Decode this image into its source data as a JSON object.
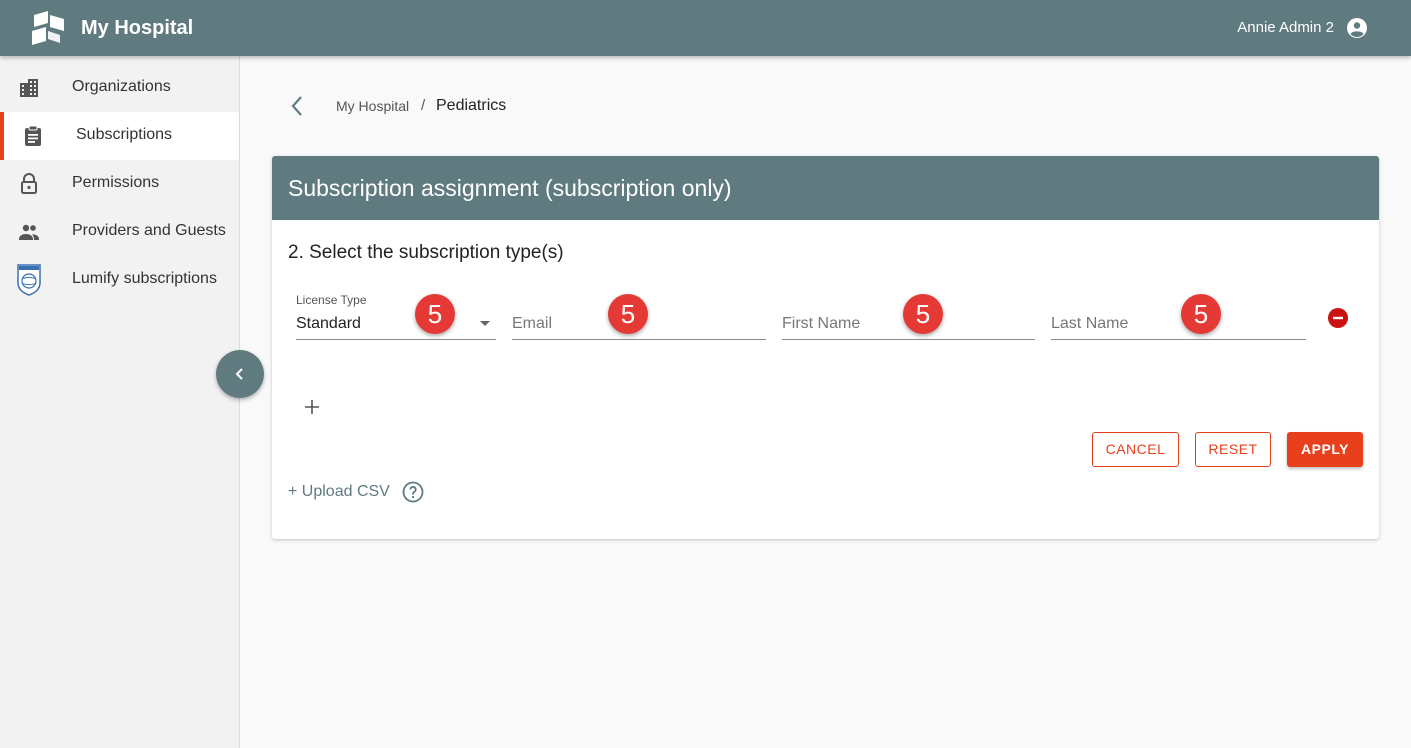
{
  "app": {
    "title": "My Hospital",
    "user_name": "Annie Admin 2"
  },
  "sidebar": {
    "items": [
      {
        "label": "Organizations",
        "icon": "building-icon"
      },
      {
        "label": "Subscriptions",
        "icon": "clipboard-icon",
        "active": true
      },
      {
        "label": "Permissions",
        "icon": "lock-icon"
      },
      {
        "label": "Providers and Guests",
        "icon": "people-icon"
      },
      {
        "label": "Lumify subscriptions",
        "icon": "philips-shield-icon"
      }
    ]
  },
  "breadcrumb": {
    "parent": "My Hospital",
    "separator": "/",
    "current": "Pediatrics"
  },
  "card": {
    "title": "Subscription assignment (subscription only)",
    "step_title": "2. Select the subscription type(s)",
    "license_type": {
      "label": "License Type",
      "value": "Standard"
    },
    "email": {
      "placeholder": "Email"
    },
    "first_name": {
      "placeholder": "First Name"
    },
    "last_name": {
      "placeholder": "Last Name"
    },
    "badges": [
      "5",
      "5",
      "5",
      "5"
    ],
    "buttons": {
      "cancel": "CANCEL",
      "reset": "RESET",
      "apply": "APPLY"
    },
    "upload_csv": "+ Upload CSV"
  },
  "colors": {
    "header": "#607b80",
    "accent": "#e8401c",
    "badge": "#e53935"
  }
}
